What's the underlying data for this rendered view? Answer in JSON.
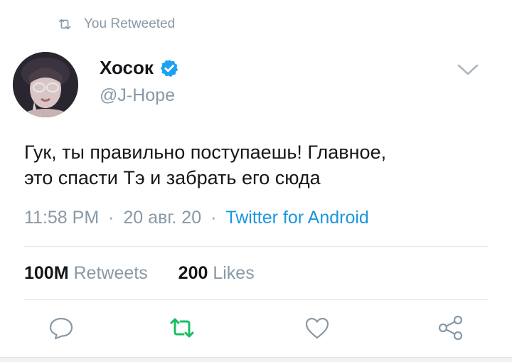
{
  "retweet_header": {
    "label": "You Retweeted"
  },
  "user": {
    "display_name": "Хосок",
    "handle": "@J-Hope",
    "verified": true
  },
  "tweet": {
    "text_line1": "Гук, ты правильно поступаешь! Главное,",
    "text_line2": "это спасти Тэ и забрать его сюда"
  },
  "meta": {
    "time": "11:58 PM",
    "separator": "·",
    "date": "20 авг. 20",
    "source": "Twitter for Android"
  },
  "stats": {
    "retweets_count": "100M",
    "retweets_label": "Retweets",
    "likes_count": "200",
    "likes_label": "Likes"
  },
  "actions": [
    "reply-icon",
    "retweet-icon",
    "like-icon",
    "share-icon"
  ],
  "colors": {
    "text": "#14171a",
    "muted": "#8899a6",
    "link": "#1b95e0",
    "verified": "#1da1f2",
    "retweet_active": "#17bf63",
    "divider": "#e1e8ed"
  }
}
